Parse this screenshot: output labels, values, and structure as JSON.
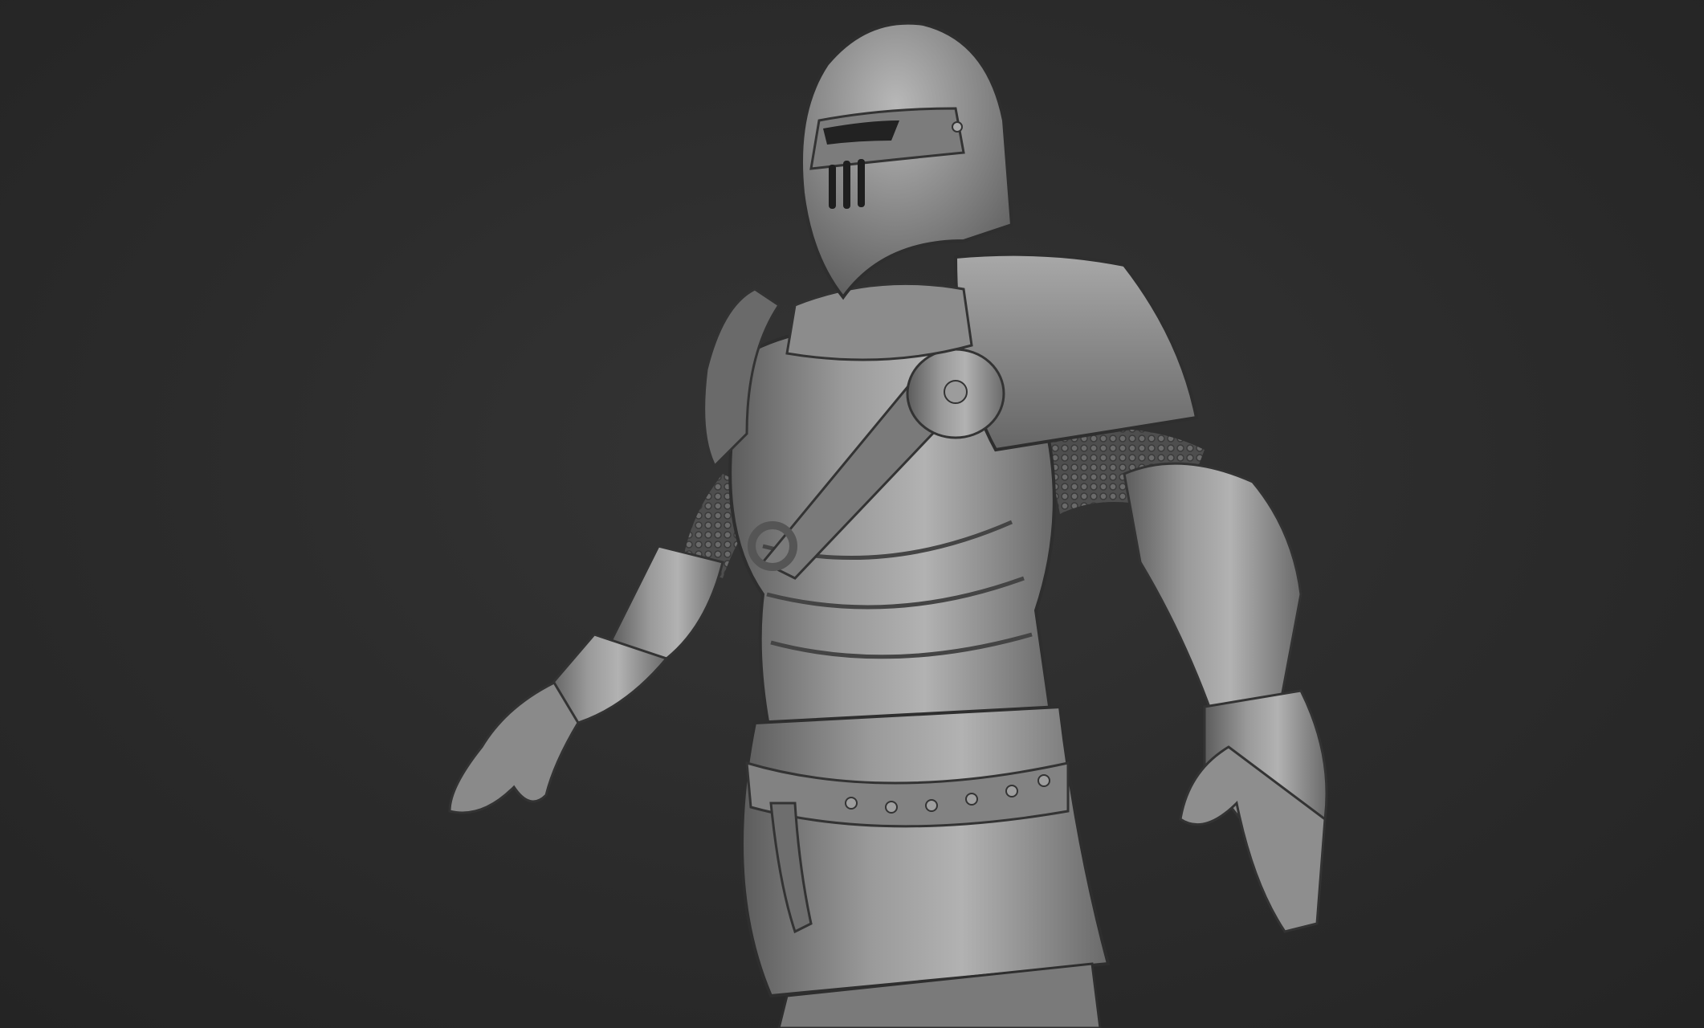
{
  "scene": {
    "subject": "knight-in-plate-armor",
    "colors": {
      "background": "#2c2c2c",
      "armor_base": "#8a8a8a",
      "armor_light": "#b4b4b4",
      "armor_dark": "#4a4a4a",
      "chainmail": "#5a5a5a"
    }
  }
}
